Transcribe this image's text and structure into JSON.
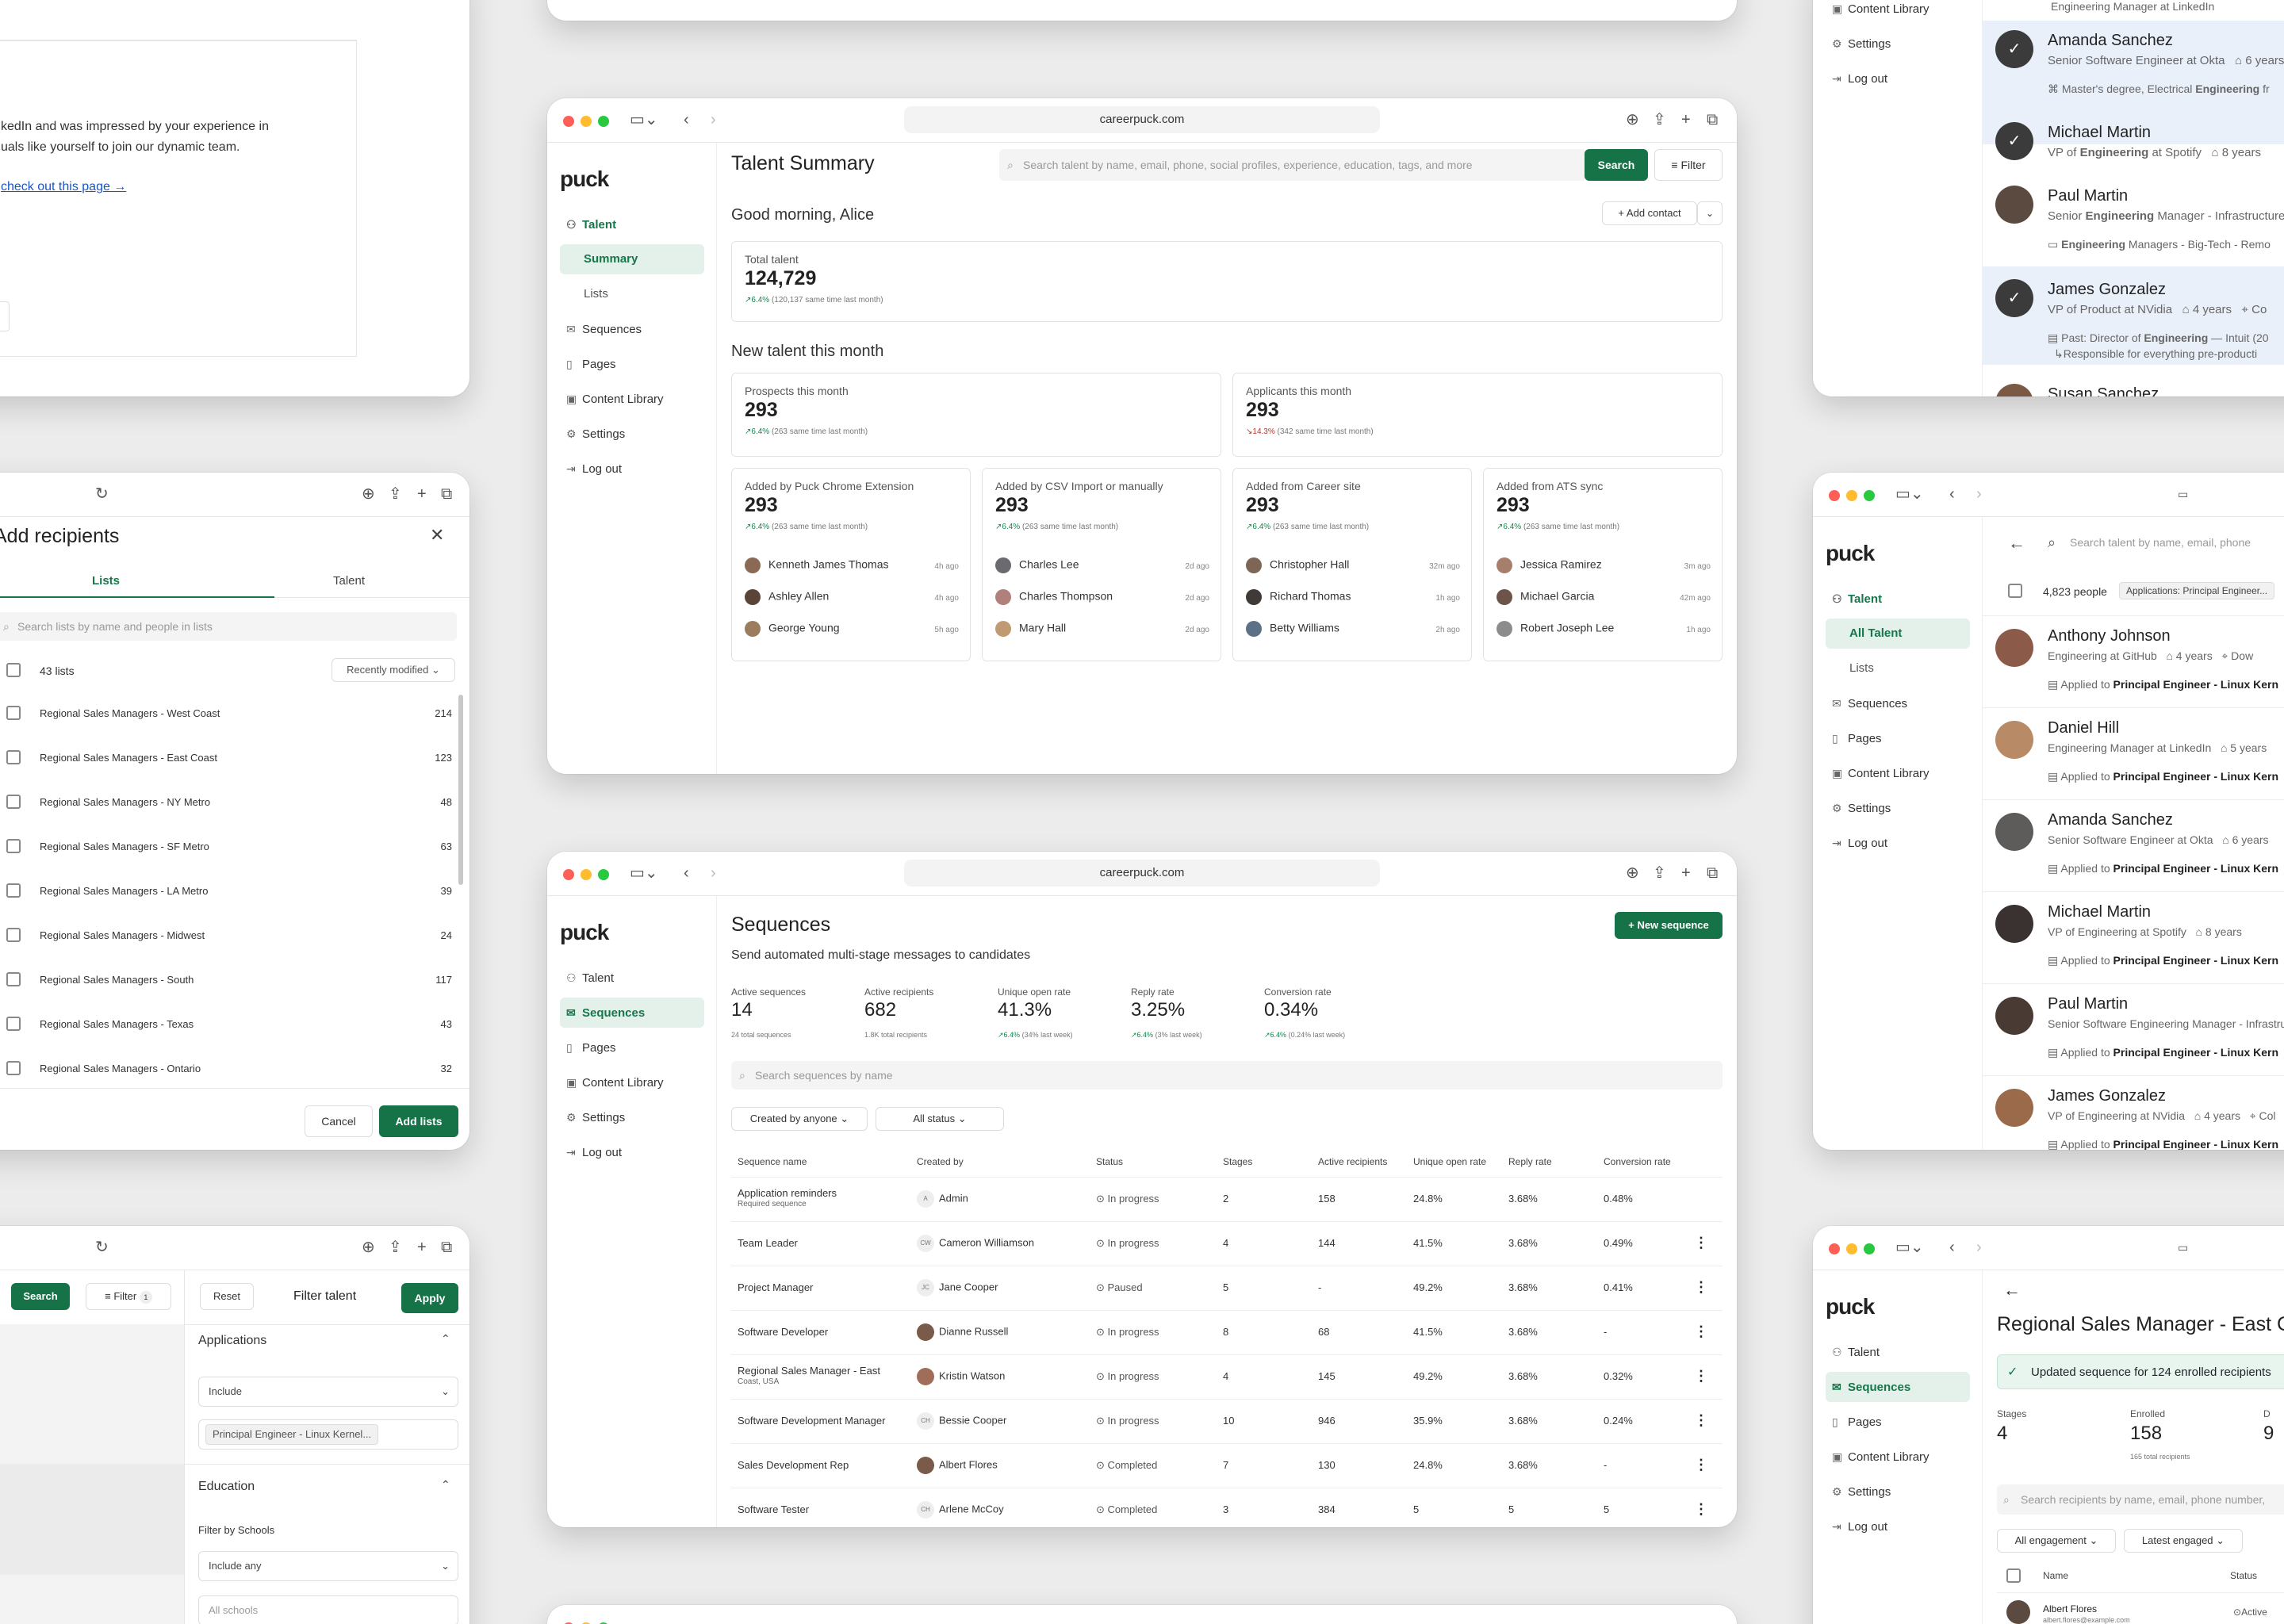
{
  "url": "careerpuck.com",
  "logo": "puck",
  "nav": {
    "talent": "Talent",
    "summary": "Summary",
    "all_talent": "All Talent",
    "lists": "Lists",
    "sequences": "Sequences",
    "pages": "Pages",
    "content_library": "Content Library",
    "settings": "Settings",
    "logout": "Log out"
  },
  "summary": {
    "title": "Talent Summary",
    "search_placeholder": "Search talent by name, email, phone, social profiles, experience, education, tags, and more",
    "search_btn": "Search",
    "filter_btn": "Filter",
    "greeting": "Good morning, Alice",
    "add_contact": "Add contact",
    "total": {
      "label": "Total talent",
      "value": "124,729",
      "pct": "6.4%",
      "note": "(120,137 same time last month)"
    },
    "new_heading": "New talent this month",
    "prospects": {
      "label": "Prospects this month",
      "value": "293",
      "pct": "6.4%",
      "note": "(263 same time last month)"
    },
    "applicants": {
      "label": "Applicants this month",
      "value": "293",
      "pct": "14.3%",
      "note": "(342 same time last month)"
    },
    "sources": [
      {
        "label": "Added by Puck Chrome Extension",
        "value": "293",
        "pct": "6.4%",
        "note": "(263 same time last month)",
        "people": [
          {
            "name": "Kenneth James Thomas",
            "ago": "4h ago"
          },
          {
            "name": "Ashley Allen",
            "ago": "4h ago"
          },
          {
            "name": "George Young",
            "ago": "5h ago"
          }
        ]
      },
      {
        "label": "Added by CSV Import or manually",
        "value": "293",
        "pct": "6.4%",
        "note": "(263 same time last month)",
        "people": [
          {
            "name": "Charles Lee",
            "ago": "2d ago"
          },
          {
            "name": "Charles Thompson",
            "ago": "2d ago"
          },
          {
            "name": "Mary Hall",
            "ago": "2d ago"
          }
        ]
      },
      {
        "label": "Added from Career site",
        "value": "293",
        "pct": "6.4%",
        "note": "(263 same time last month)",
        "people": [
          {
            "name": "Christopher Hall",
            "ago": "32m ago"
          },
          {
            "name": "Richard Thomas",
            "ago": "1h ago"
          },
          {
            "name": "Betty Williams",
            "ago": "2h ago"
          }
        ]
      },
      {
        "label": "Added from ATS sync",
        "value": "293",
        "pct": "6.4%",
        "note": "(263 same time last month)",
        "people": [
          {
            "name": "Jessica Ramirez",
            "ago": "3m ago"
          },
          {
            "name": "Michael Garcia",
            "ago": "42m ago"
          },
          {
            "name": "Robert Joseph Lee",
            "ago": "1h ago"
          }
        ]
      }
    ]
  },
  "sequences": {
    "title": "Sequences",
    "subtitle": "Send automated multi-stage messages to candidates",
    "new_btn": "New sequence",
    "stats": [
      {
        "label": "Active sequences",
        "value": "14",
        "note": "24 total sequences",
        "pct": ""
      },
      {
        "label": "Active recipients",
        "value": "682",
        "note": "1.8K total recipients",
        "pct": ""
      },
      {
        "label": "Unique open rate",
        "value": "41.3%",
        "pct": "6.4%",
        "note": "(34% last week)"
      },
      {
        "label": "Reply rate",
        "value": "3.25%",
        "pct": "6.4%",
        "note": "(3% last week)"
      },
      {
        "label": "Conversion rate",
        "value": "0.34%",
        "pct": "6.4%",
        "note": "(0.24% last week)"
      }
    ],
    "search_placeholder": "Search sequences by name",
    "filter_created": "Created by anyone",
    "filter_status": "All status",
    "columns": [
      "Sequence name",
      "Created by",
      "Status",
      "Stages",
      "Active recipients",
      "Unique open rate",
      "Reply rate",
      "Conversion rate"
    ],
    "rows": [
      {
        "name": "Application reminders",
        "sub": "Required sequence",
        "ini": "A",
        "by": "Admin",
        "status": "In progress",
        "stages": "2",
        "active": "158",
        "open": "24.8%",
        "reply": "3.68%",
        "conv": "0.48%",
        "menu": false,
        "photo": false
      },
      {
        "name": "Team Leader",
        "sub": "",
        "ini": "CW",
        "by": "Cameron Williamson",
        "status": "In progress",
        "stages": "4",
        "active": "144",
        "open": "41.5%",
        "reply": "3.68%",
        "conv": "0.49%",
        "menu": true,
        "photo": false
      },
      {
        "name": "Project Manager",
        "sub": "",
        "ini": "JC",
        "by": "Jane Cooper",
        "status": "Paused",
        "stages": "5",
        "active": "-",
        "open": "49.2%",
        "reply": "3.68%",
        "conv": "0.41%",
        "menu": true,
        "photo": false
      },
      {
        "name": "Software Developer",
        "sub": "",
        "ini": "",
        "by": "Dianne Russell",
        "status": "In progress",
        "stages": "8",
        "active": "68",
        "open": "41.5%",
        "reply": "3.68%",
        "conv": "-",
        "menu": true,
        "photo": true
      },
      {
        "name": "Regional Sales Manager - East",
        "sub": "Coast, USA",
        "ini": "",
        "by": "Kristin Watson",
        "status": "In progress",
        "stages": "4",
        "active": "145",
        "open": "49.2%",
        "reply": "3.68%",
        "conv": "0.32%",
        "menu": true,
        "photo": true
      },
      {
        "name": "Software Development Manager",
        "sub": "",
        "ini": "CH",
        "by": "Bessie Cooper",
        "status": "In progress",
        "stages": "10",
        "active": "946",
        "open": "35.9%",
        "reply": "3.68%",
        "conv": "0.24%",
        "menu": true,
        "photo": false
      },
      {
        "name": "Sales Development Rep",
        "sub": "",
        "ini": "",
        "by": "Albert Flores",
        "status": "Completed",
        "stages": "7",
        "active": "130",
        "open": "24.8%",
        "reply": "3.68%",
        "conv": "-",
        "menu": true,
        "photo": true
      },
      {
        "name": "Software Tester",
        "sub": "",
        "ini": "CH",
        "by": "Arlene McCoy",
        "status": "Completed",
        "stages": "3",
        "active": "384",
        "open": "5",
        "reply": "5",
        "conv": "5",
        "menu": true,
        "photo": false
      }
    ]
  },
  "email": {
    "line1": "kedIn and was impressed by your experience in",
    "line2": "uals like yourself to join our dynamic team.",
    "link": "check out this page →"
  },
  "recipients": {
    "title": "Add recipients",
    "tab_lists": "Lists",
    "tab_talent": "Talent",
    "search_placeholder": "Search lists by name and people in lists",
    "count": "43 lists",
    "sort": "Recently modified",
    "lists": [
      {
        "name": "Regional Sales Managers - West Coast",
        "n": "214"
      },
      {
        "name": "Regional Sales Managers - East Coast",
        "n": "123"
      },
      {
        "name": "Regional Sales Managers - NY Metro",
        "n": "48"
      },
      {
        "name": "Regional Sales Managers - SF Metro",
        "n": "63"
      },
      {
        "name": "Regional Sales Managers - LA Metro",
        "n": "39"
      },
      {
        "name": "Regional Sales Managers - Midwest",
        "n": "24"
      },
      {
        "name": "Regional Sales Managers - South",
        "n": "117"
      },
      {
        "name": "Regional Sales Managers - Texas",
        "n": "43"
      },
      {
        "name": "Regional Sales Managers - Ontario",
        "n": "32"
      }
    ],
    "cancel": "Cancel",
    "add": "Add lists"
  },
  "filterpanel": {
    "search": "Search",
    "filter": "Filter",
    "badge": "1",
    "reset": "Reset",
    "title": "Filter talent",
    "apply": "Apply",
    "applications": "Applications",
    "include": "Include",
    "job": "Principal Engineer - Linux Kernel...",
    "education": "Education",
    "by_schools": "Filter by Schools",
    "include_any": "Include any",
    "all_schools": "All schools"
  },
  "topright": {
    "people": [
      {
        "name": "Amanda Sanchez",
        "role": "Senior Software Engineer at",
        "co": "Okta",
        "yrs": "6 years",
        "detail_a": "Master's degree, Electrical ",
        "detail_b": "Engineering",
        "detail_c": " fr"
      },
      {
        "name": "Michael Martin",
        "role": "VP of ",
        "role_b": "Engineering",
        "role_c": " at",
        "co": "Spotify",
        "yrs": "8 years"
      },
      {
        "name": "Paul Martin",
        "role": "Senior ",
        "role_b": "Engineering",
        "role_c": " Manager - Infrastructure",
        "detail_a": "",
        "detail_b": "Engineering",
        "detail_c": " Managers - Big-Tech - Remo"
      },
      {
        "name": "James Gonzalez",
        "role": "VP of Product at",
        "co": "NVidia",
        "yrs": "4 years",
        "loc": "Co",
        "detail_a": "Past: Director of ",
        "detail_b": "Engineering",
        "detail_c": " — Intuit (20",
        "detail_d": "↳Responsible for everything pre-producti"
      },
      {
        "name": "Susan Sanchez"
      }
    ],
    "top_line": "Engineering Manager at LinkedIn"
  },
  "alltalent": {
    "search_placeholder": "Search talent by name, email, phone",
    "count": "4,823 people",
    "chip": "Applications: Principal Engineer...",
    "applied": "Applied to ",
    "job": "Principal Engineer - Linux Kern",
    "people": [
      {
        "name": "Anthony Johnson",
        "role": "Engineering at",
        "co": "GitHub",
        "yrs": "4 years",
        "loc": "Dow"
      },
      {
        "name": "Daniel Hill",
        "role": "Engineering Manager at",
        "co": "LinkedIn",
        "yrs": "5 years",
        "loc": ""
      },
      {
        "name": "Amanda Sanchez",
        "role": "Senior Software Engineer at",
        "co": "Okta",
        "yrs": "6 years",
        "loc": ""
      },
      {
        "name": "Michael Martin",
        "role": "VP of Engineering at",
        "co": "Spotify",
        "yrs": "8 years",
        "loc": ""
      },
      {
        "name": "Paul Martin",
        "role": "Senior Software Engineering Manager - Infrastructure",
        "co": "",
        "yrs": "",
        "loc": ""
      },
      {
        "name": "James Gonzalez",
        "role": "VP of Engineering at",
        "co": "NVidia",
        "yrs": "4 years",
        "loc": "Col"
      }
    ]
  },
  "seqdetail": {
    "title": "Regional Sales Manager - East C",
    "banner": "Updated sequence for 124 enrolled recipients",
    "stages_label": "Stages",
    "stages": "4",
    "enrolled_label": "Enrolled",
    "enrolled": "158",
    "enrolled_note": "165 total recipients",
    "third_label": "D",
    "third_val": "9",
    "search_placeholder": "Search recipients by name, email, phone number,",
    "eng": "All engagement",
    "latest": "Latest engaged",
    "col_name": "Name",
    "col_status": "Status",
    "row_name": "Albert Flores",
    "row_email": "albert.flores@example.com",
    "row_status": "Active"
  }
}
